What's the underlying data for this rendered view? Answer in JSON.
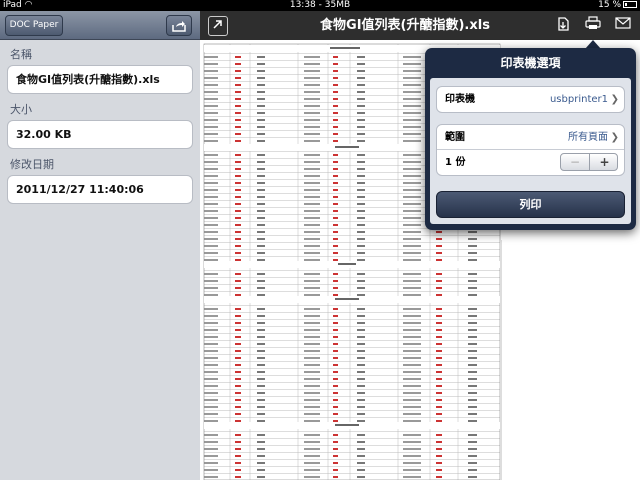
{
  "status_bar": {
    "device": "iPad",
    "time": "13:38 - 35MB",
    "battery": "15 %"
  },
  "left_panel": {
    "doc_button": "DOC Paper",
    "fields": [
      {
        "label": "名稱",
        "value": "食物GI值列表(升醣指數).xls"
      },
      {
        "label": "大小",
        "value": "32.00 KB"
      },
      {
        "label": "修改日期",
        "value": "2011/12/27 11:40:06"
      }
    ]
  },
  "document": {
    "title": "食物GI值列表(升醣指數).xls"
  },
  "printer_options": {
    "title": "印表機選項",
    "printer_label": "印表機",
    "printer_value": "usbprinter1",
    "range_label": "範圍",
    "range_value": "所有頁面",
    "copies_label": "1 份",
    "minus": "−",
    "plus": "+",
    "print_button": "列印"
  },
  "icons": {
    "share": "share-icon",
    "expand": "expand-icon",
    "save": "save-icon",
    "print": "printer-icon",
    "mail": "mail-icon"
  }
}
